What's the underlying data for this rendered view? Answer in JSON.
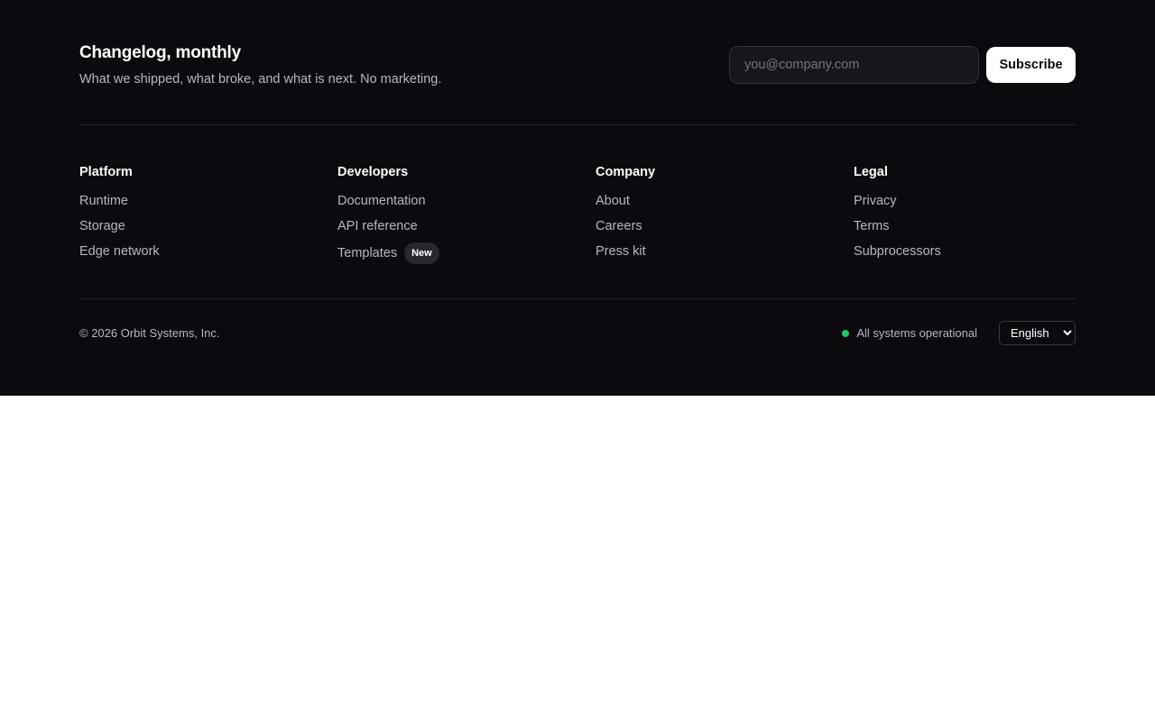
{
  "newsletter": {
    "title": "Changelog, monthly",
    "subtitle": "What we shipped, what broke, and what is next. No marketing.",
    "email_placeholder": "you@company.com",
    "subscribe_label": "Subscribe"
  },
  "columns": [
    {
      "title": "Platform",
      "links": [
        {
          "label": "Runtime"
        },
        {
          "label": "Storage"
        },
        {
          "label": "Edge network"
        }
      ]
    },
    {
      "title": "Developers",
      "links": [
        {
          "label": "Documentation"
        },
        {
          "label": "API reference"
        },
        {
          "label": "Templates",
          "badge": "New"
        }
      ]
    },
    {
      "title": "Company",
      "links": [
        {
          "label": "About"
        },
        {
          "label": "Careers"
        },
        {
          "label": "Press kit"
        }
      ]
    },
    {
      "title": "Legal",
      "links": [
        {
          "label": "Privacy"
        },
        {
          "label": "Terms"
        },
        {
          "label": "Subprocessors"
        }
      ]
    }
  ],
  "bottom": {
    "copyright": "© 2026 Orbit Systems, Inc.",
    "status_text": "All systems operational",
    "status_color": "#22c55e",
    "language_selected": "English"
  }
}
